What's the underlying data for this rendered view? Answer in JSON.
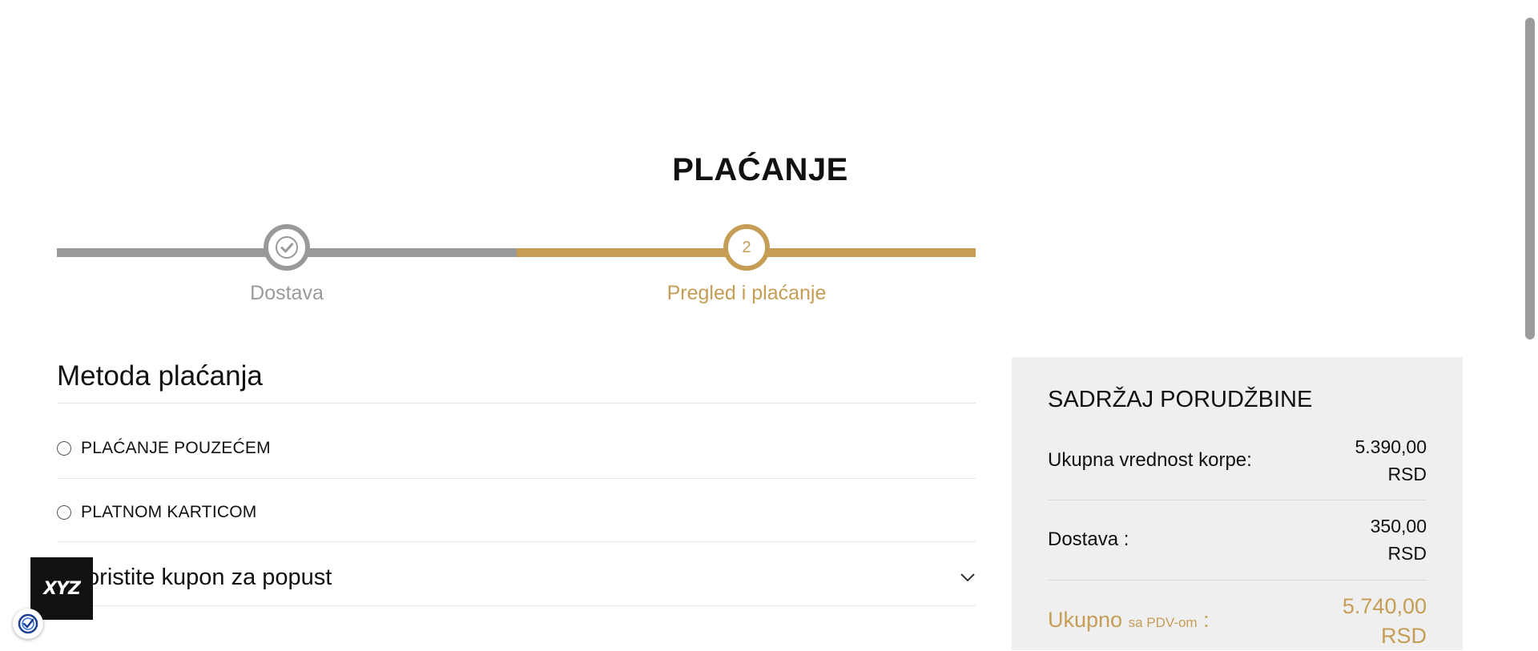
{
  "page": {
    "title": "PLAĆANJE"
  },
  "stepper": {
    "steps": [
      {
        "label": "Dostava",
        "state": "completed",
        "icon": "check-icon"
      },
      {
        "label": "Pregled i plaćanje",
        "number": "2",
        "state": "active"
      }
    ],
    "colors": {
      "completed": "#999999",
      "active": "#c59d55"
    }
  },
  "payment": {
    "section_title": "Metoda plaćanja",
    "options": [
      {
        "label": "PLAĆANJE POUZEĆEM",
        "selected": false
      },
      {
        "label": "PLATNOM KARTICOM",
        "selected": false
      }
    ],
    "coupon_label": "Iskoristite kupon za popust"
  },
  "summary": {
    "title": "SADRŽAJ PORUDŽBINE",
    "cart_label": "Ukupna vrednost korpe:",
    "cart_value": "5.390,00",
    "cart_currency": "RSD",
    "shipping_label": "Dostava :",
    "shipping_value": "350,00",
    "shipping_currency": "RSD",
    "total_label": "Ukupno",
    "total_vat_note": "sa PDV-om",
    "total_colon": ":",
    "total_value": "5.740,00",
    "total_currency": "RSD"
  },
  "widget": {
    "logo_text": "XYZ",
    "badge_icon": "shield-check-icon"
  },
  "colors": {
    "accent": "#c59d55",
    "inactive": "#999999",
    "summary_bg": "#efefef"
  }
}
